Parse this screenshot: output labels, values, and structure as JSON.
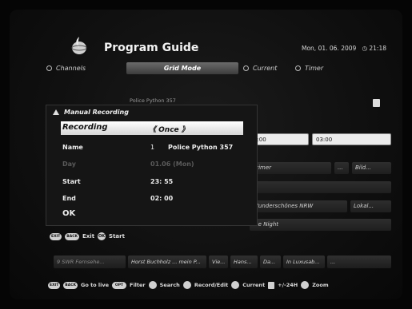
{
  "header": {
    "title": "Program Guide",
    "date": "Mon, 01. 06. 2009",
    "time": "21:18",
    "logo_icon": "globe-logo-icon"
  },
  "modes": [
    {
      "label": "Channels",
      "active": false
    },
    {
      "label": "Grid Mode",
      "active": true
    },
    {
      "label": "Current",
      "active": false
    },
    {
      "label": "Timer",
      "active": false
    }
  ],
  "grid": {
    "top_channel": "Police Python 357",
    "time_cells": [
      "2:00",
      "03:00"
    ],
    "rows": [
      [
        "Primer",
        "...",
        "Bild..."
      ],
      [
        "Wunderschönes NRW",
        "Lokal..."
      ],
      [
        "...e Night"
      ]
    ]
  },
  "dialog": {
    "title": "Manual Recording",
    "rows": {
      "recording": {
        "label": "Recording",
        "value": "Once"
      },
      "name": {
        "label": "Name",
        "index": "1",
        "value": "Police Python 357"
      },
      "day": {
        "label": "Day",
        "value": "01.06 (Mon)"
      },
      "start": {
        "label": "Start",
        "value": "23: 55"
      },
      "end": {
        "label": "End",
        "value": "02: 00"
      },
      "ok": {
        "label": "OK"
      }
    }
  },
  "hints": {
    "exit_label": "Exit",
    "start_label": "Start",
    "exit_key": "EXIT",
    "back_key": "BACK",
    "ok_key": "OK"
  },
  "bottom_programmes": [
    "9 SWR Fernsehe...",
    "Horst Buchholz ... mein P...",
    "Vie...",
    "Hans...",
    "Da...",
    "In Luxusab...",
    "..."
  ],
  "legend": {
    "goto_live": "Go to live",
    "filter": "Filter",
    "search": "Search",
    "record_edit": "Record/Edit",
    "current": "Current",
    "pages": "+/-24H",
    "zoom": "Zoom",
    "exit_key": "EXIT",
    "back_key": "BACK",
    "filter_key": "OPT"
  }
}
